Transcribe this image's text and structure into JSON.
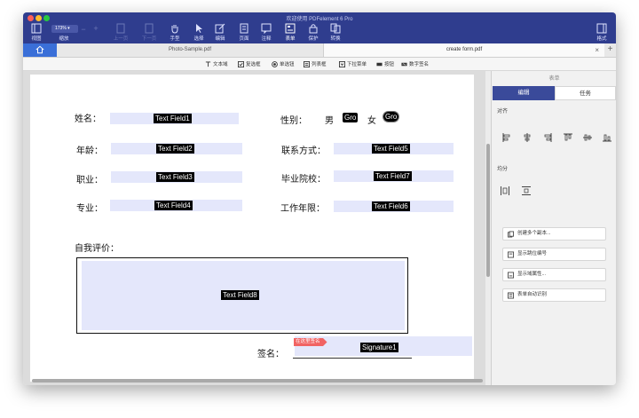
{
  "window": {
    "title": "欢迎使用 PDFelement 6 Pro"
  },
  "toolbar": {
    "items": [
      {
        "label": "视图"
      },
      {
        "label": "缩放"
      },
      {
        "label": "上一页"
      },
      {
        "label": "下一页"
      },
      {
        "label": "手型"
      },
      {
        "label": "选择"
      },
      {
        "label": "编辑"
      },
      {
        "label": "页面"
      },
      {
        "label": "注释"
      },
      {
        "label": "表单"
      },
      {
        "label": "保护"
      },
      {
        "label": "转换"
      },
      {
        "label": "格式"
      }
    ],
    "zoom_value": "173%"
  },
  "tabs": [
    {
      "label": "Photo-Sample.pdf"
    },
    {
      "label": "create form.pdf"
    }
  ],
  "form_toolbar": [
    {
      "label": "文本域"
    },
    {
      "label": "复选框"
    },
    {
      "label": "单选钮"
    },
    {
      "label": "列表框"
    },
    {
      "label": "下拉菜单"
    },
    {
      "label": "按钮"
    },
    {
      "label": "数字签名"
    }
  ],
  "form": {
    "name_label": "姓名：",
    "age_label": "年龄：",
    "job_label": "职业：",
    "major_label": "专业：",
    "gender_label": "性别：",
    "male": "男",
    "female": "女",
    "contact_label": "联系方式：",
    "school_label": "毕业院校：",
    "years_label": "工作年限：",
    "self_eval_label": "自我评价：",
    "sign_label": "签名：",
    "sign_hint": "在这里签名",
    "fields": {
      "f1": "Text Field1",
      "f2": "Text Field2",
      "f3": "Text Field3",
      "f4": "Text Field4",
      "f5": "Text Field5",
      "f6": "Text Field6",
      "f7": "Text Field7",
      "f8": "Text Field8",
      "radio1": "Gro",
      "radio2": "Gro",
      "sig": "Signature1"
    }
  },
  "panel": {
    "title": "表单",
    "tab_edit": "编辑",
    "tab_task": "任务",
    "align_label": "对齐",
    "distribute_label": "均分",
    "buttons": [
      {
        "label": "创建多个副本..."
      },
      {
        "label": "显示跳位编号"
      },
      {
        "label": "显示域属性..."
      },
      {
        "label": "表单自动识别"
      }
    ]
  },
  "colors": {
    "titlebar": "#2f3d8e",
    "home_tab": "#3a6fd8",
    "field_fill": "#e4e7fb",
    "active_tab": "#3a4a9a"
  }
}
